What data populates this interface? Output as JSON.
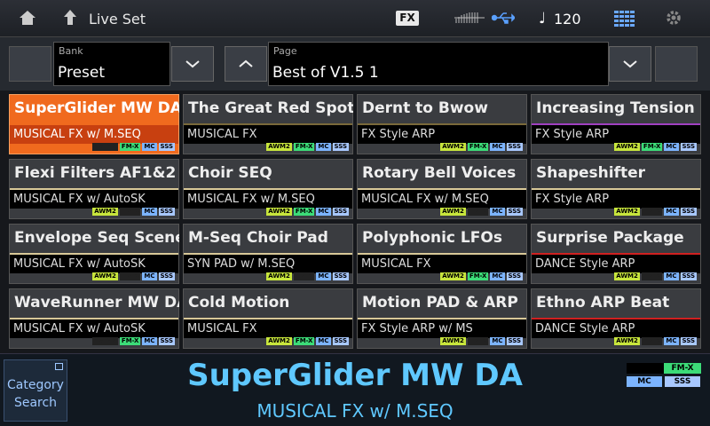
{
  "topbar": {
    "title": "Live Set",
    "fx_label": "FX",
    "tempo": "120",
    "icons": [
      "home-icon",
      "up-arrow-icon",
      "midi-icon",
      "usb-icon",
      "note-icon",
      "grid-icon",
      "gear-icon"
    ]
  },
  "bank": {
    "label": "Bank",
    "value": "Preset"
  },
  "page": {
    "label": "Page",
    "value": "Best of V1.5  1"
  },
  "cells": [
    {
      "name": "SuperGlider MW DA",
      "category": "MUSICAL FX w/ M.SEQ",
      "bar": "#f06a1e",
      "awm": false,
      "fm": true
    },
    {
      "name": "The Great Red Spot",
      "category": "MUSICAL FX",
      "bar": "#7a6a3a",
      "awm": true,
      "fm": true
    },
    {
      "name": "Dernt to Bwow",
      "category": "FX Style ARP",
      "bar": "#7a6a3a",
      "awm": true,
      "fm": true
    },
    {
      "name": "Increasing Tension",
      "category": "FX Style ARP",
      "bar": "#a040c0",
      "awm": true,
      "fm": true
    },
    {
      "name": "Flexi Filters AF1&2",
      "category": "MUSICAL FX w/ AutoSK",
      "bar": "#d8c898",
      "awm": true,
      "fm": false
    },
    {
      "name": "Choir SEQ",
      "category": "MUSICAL FX w/ M.SEQ",
      "bar": "#d8c898",
      "awm": true,
      "fm": true
    },
    {
      "name": "Rotary Bell Voices",
      "category": "MUSICAL FX w/ M.SEQ",
      "bar": "#d8c898",
      "awm": true,
      "fm": false
    },
    {
      "name": "Shapeshifter",
      "category": "FX Style ARP",
      "bar": "#d8c898",
      "awm": true,
      "fm": false
    },
    {
      "name": "Envelope Seq Scenes",
      "category": "MUSICAL FX w/ AutoSK",
      "bar": "#d8c898",
      "awm": true,
      "fm": false
    },
    {
      "name": "M-Seq Choir Pad",
      "category": "SYN PAD w/ M.SEQ",
      "bar": "#d8c898",
      "awm": true,
      "fm": false
    },
    {
      "name": "Polyphonic LFOs",
      "category": "MUSICAL FX",
      "bar": "#d8c898",
      "awm": true,
      "fm": true
    },
    {
      "name": "Surprise Package",
      "category": "DANCE Style ARP",
      "bar": "#d02020",
      "awm": true,
      "fm": false
    },
    {
      "name": "WaveRunner MW DA",
      "category": "MUSICAL FX w/ AutoSK",
      "bar": "#d8c898",
      "awm": false,
      "fm": true
    },
    {
      "name": "Cold Motion",
      "category": "MUSICAL FX",
      "bar": "#d8c898",
      "awm": true,
      "fm": true
    },
    {
      "name": "Motion PAD & ARP",
      "category": "FX Style ARP w/ MS",
      "bar": "#d8c898",
      "awm": true,
      "fm": false
    },
    {
      "name": "Ethno ARP Beat",
      "category": "DANCE Style ARP",
      "bar": "#d02020",
      "awm": true,
      "fm": false
    }
  ],
  "badges": {
    "awm": "AWM2",
    "fm": "FM-X",
    "mc": "MC",
    "sss": "SSS"
  },
  "category_search": {
    "line1": "Category",
    "line2": "Search"
  },
  "current": {
    "name": "SuperGlider MW DA",
    "category": "MUSICAL FX w/ M.SEQ"
  },
  "colors": {
    "accent": "#f06a1e",
    "info": "#5fc8ff"
  }
}
